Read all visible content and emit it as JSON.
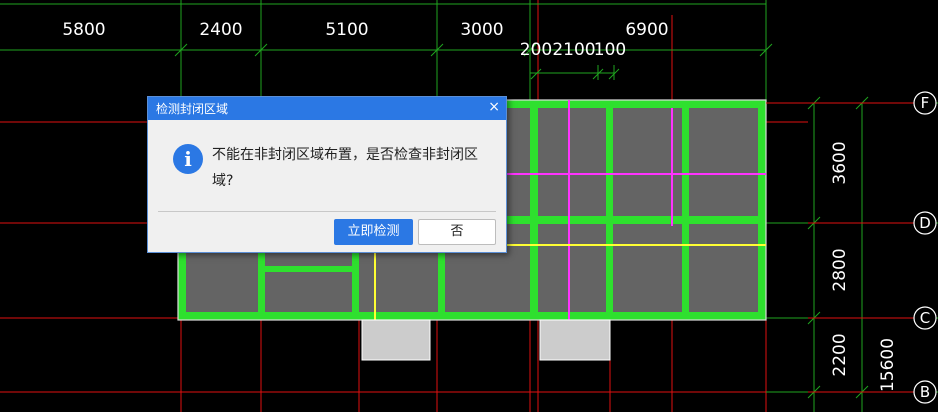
{
  "top_dimensions": [
    "5800",
    "2400",
    "5100",
    "3000",
    "6900"
  ],
  "sub_dimensions": [
    "200",
    "2100",
    "100"
  ],
  "side_dimensions": [
    "3600",
    "2800",
    "2200"
  ],
  "total_dimension": "15600",
  "axis_labels": [
    "F",
    "D",
    "C",
    "B"
  ],
  "dialog": {
    "title": "检测封闭区域",
    "close_glyph": "×",
    "info_glyph": "i",
    "message": "不能在非封闭区域布置，是否检查非封闭区域?",
    "confirm_label": "立即检测",
    "cancel_label": "否"
  },
  "colors": {
    "background": "#000000",
    "grid_red": "#e01010",
    "dim_green": "#1fa51f",
    "beam_green": "#2ee02e",
    "slab_gray": "#646464",
    "magenta": "#ff33ff",
    "yellow": "#ffff33",
    "dialog_blue": "#2b78e4"
  }
}
